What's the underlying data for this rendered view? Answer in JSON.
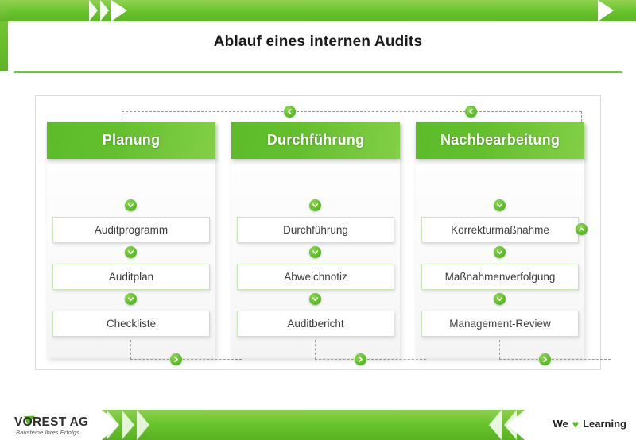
{
  "slide": {
    "title": "Ablauf eines internen Audits",
    "accent_green": "#5cb526",
    "accent_green_light": "#8fd14f",
    "step_border": "#c9e6b6"
  },
  "columns": [
    {
      "id": "planung",
      "header": "Planung",
      "steps": [
        "Auditprogramm",
        "Auditplan",
        "Checkliste"
      ]
    },
    {
      "id": "durchfuehrung",
      "header": "Durchführung",
      "steps": [
        "Durchführung",
        "Abweichnotiz",
        "Auditbericht"
      ]
    },
    {
      "id": "nachbearbeitung",
      "header": "Nachbearbeitung",
      "steps": [
        "Korrekturmaßnahme",
        "Maßnahmenverfolgung",
        "Management-Review"
      ]
    }
  ],
  "connectors": {
    "down_arrow_icon": "chevron-down-circle-icon",
    "forward_arrow_icon": "chevron-right-circle-icon",
    "back_arrow_icon": "chevron-left-circle-icon",
    "up_arrow_icon": "chevron-up-circle-icon"
  },
  "footer": {
    "logo_name": "VOREST AG",
    "logo_tagline": "Bausteine Ihres Erfolgs",
    "slogan_pre": "We",
    "slogan_heart": "♥",
    "slogan_post": "Learning"
  }
}
